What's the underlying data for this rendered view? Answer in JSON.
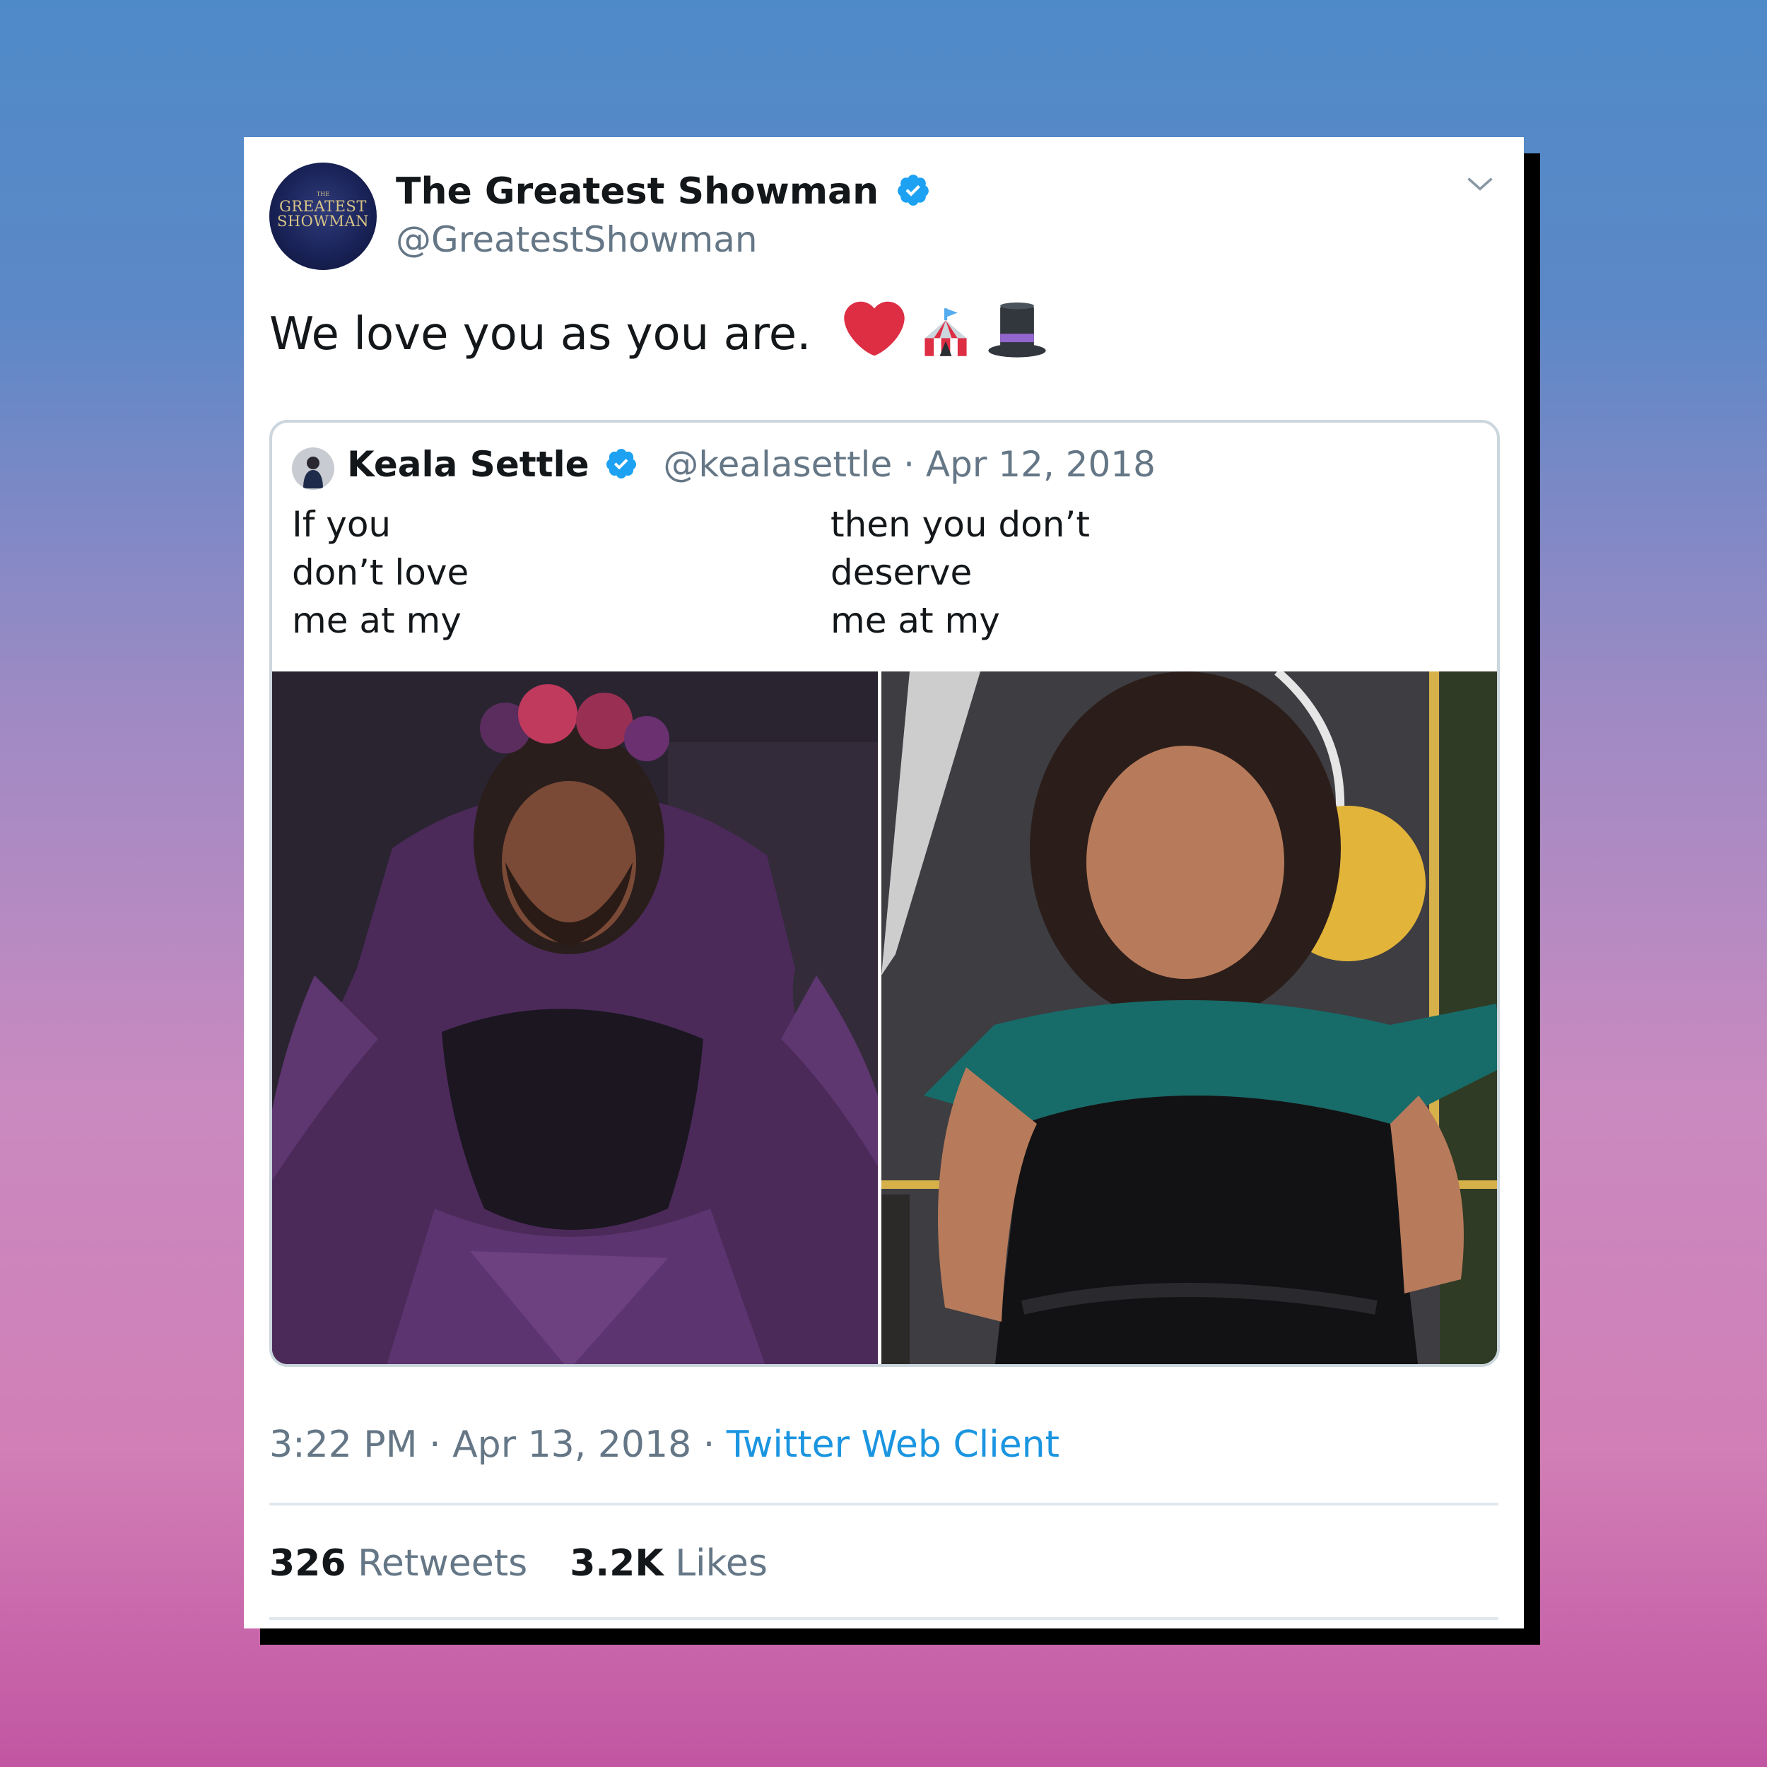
{
  "tweet": {
    "author_name": "The Greatest Showman",
    "author_handle": "@GreatestShowman",
    "avatar_small": "THE",
    "avatar_line1": "GREATEST",
    "avatar_line2": "SHOWMAN",
    "text": "We love you as you are.",
    "emojis": [
      "heart-icon",
      "circus-tent-icon",
      "top-hat-icon"
    ],
    "timestamp": "3:22 PM · Apr 13, 2018 · ",
    "client": "Twitter Web Client",
    "retweets_count": "326",
    "retweets_label": "Retweets",
    "likes_count": "3.2K",
    "likes_label": "Likes"
  },
  "quoted": {
    "author_name": "Keala Settle",
    "author_handle_date": "@kealasettle · Apr 12, 2018",
    "left_lines": [
      "If you",
      "don’t love",
      "me at my"
    ],
    "right_lines": [
      "then you don’t",
      "deserve",
      "me at my"
    ]
  },
  "colors": {
    "verified": "#1da1f2",
    "link": "#1b95e0",
    "secondary_text": "#657786",
    "primary_text": "#14171a"
  }
}
